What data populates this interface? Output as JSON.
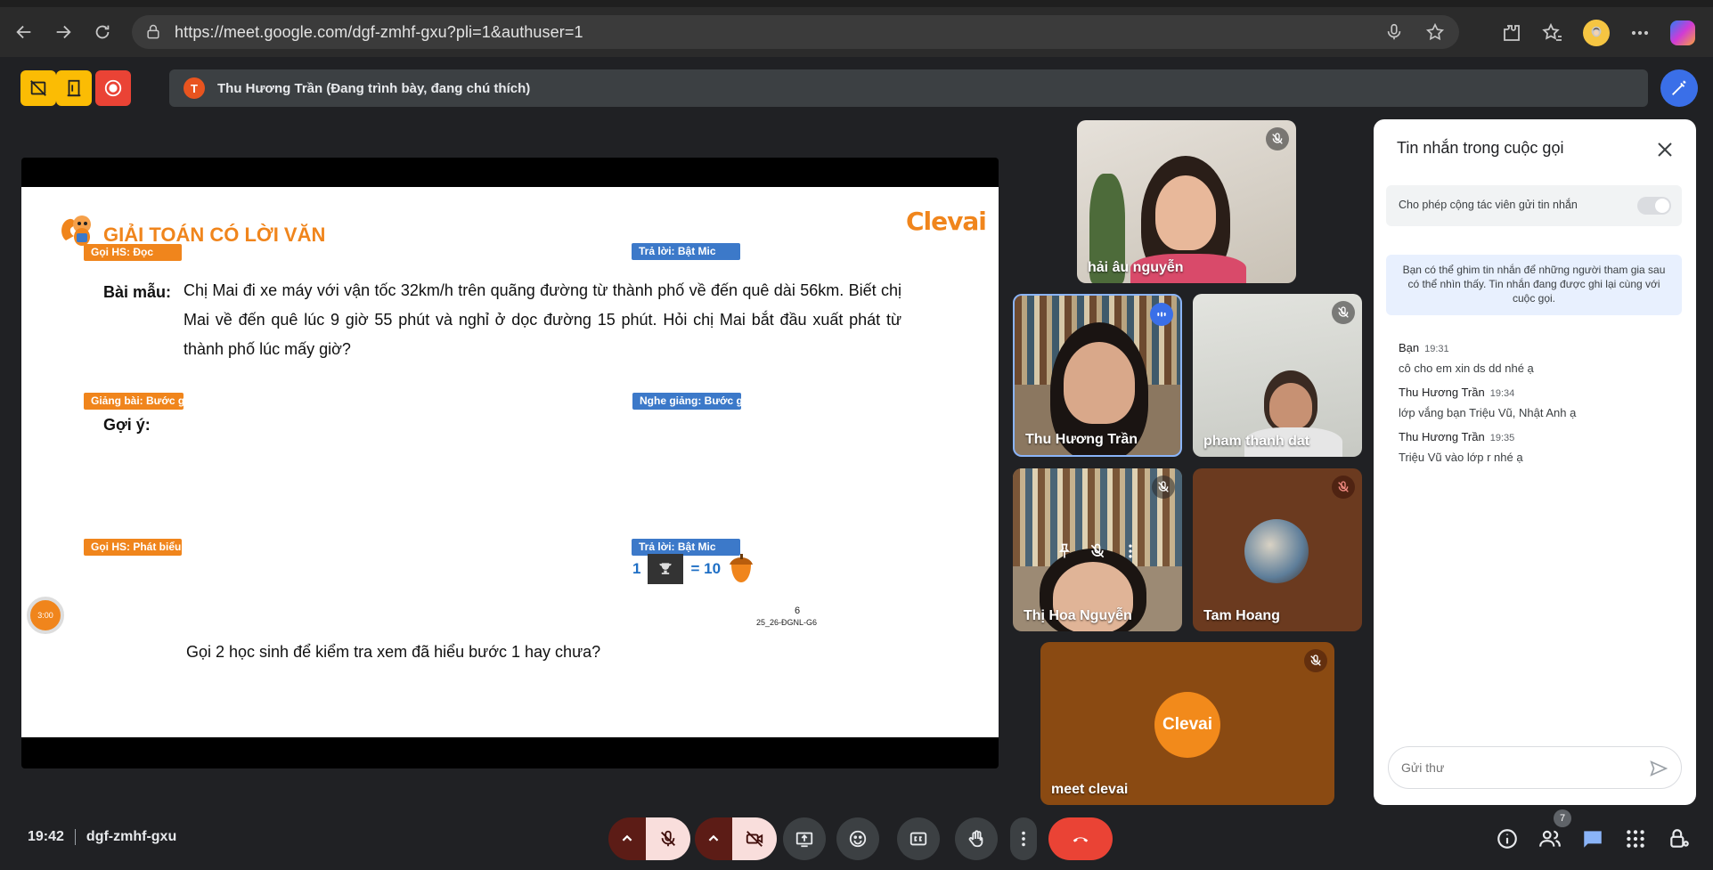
{
  "browser": {
    "url": "https://meet.google.com/dgf-zmhf-gxu?pli=1&authuser=1"
  },
  "topbar": {
    "presenter_initial": "T",
    "presenter_text": "Thu Hương Trần (Đang trình bày, đang chú thích)"
  },
  "slide": {
    "title": "GIẢI TOÁN CÓ LỜI VĂN",
    "brand": "Clevai",
    "tag_goi_hs_doc": "Gọi HS: Đọc",
    "tag_tra_loi_1": "Trả lời: Bật Mic",
    "bai_mau_label": "Bài mẫu:",
    "problem": "Chị Mai đi xe máy với vận tốc 32km/h trên quãng đường từ thành phố về đến quê dài 56km. Biết chị Mai về đến quê lúc 9 giờ 55 phút và nghỉ ở dọc đường 15 phút. Hỏi chị Mai bắt đầu xuất phát từ thành phố lúc mấy giờ?",
    "goi_y_label": "Gợi ý:",
    "tag_giang_bai": "Giảng bài: Bước giải",
    "tag_nghe_giang": "Nghe giảng: Bước giải",
    "tag_goi_hs_phat_bieu": "Gọi HS: Phát biểu",
    "tag_tra_loi_2": "Trả lời: Bật Mic",
    "question": "Gọi 2 học sinh để kiểm tra xem đã hiểu bước 1 hay chưa?",
    "reward_count": "1",
    "reward_value": "= 10",
    "page_number": "6",
    "slide_code": "25_26-ĐGNL-G6",
    "timer": "3:00"
  },
  "participants": [
    {
      "name": "hải âu nguyễn"
    },
    {
      "name": "Thu Hương Trần"
    },
    {
      "name": "pham thanh dat"
    },
    {
      "name": "Thị Hoa Nguyễn"
    },
    {
      "name": "Tam Hoang"
    },
    {
      "name": "meet clevai",
      "logo": "Clevai"
    }
  ],
  "chat": {
    "title": "Tin nhắn trong cuộc gọi",
    "allow_label": "Cho phép cộng tác viên gửi tin nhắn",
    "info": "Bạn có thể ghim tin nhắn để những người tham gia sau có thể nhìn thấy. Tin nhắn đang được ghi lại cùng với cuộc gọi.",
    "messages": [
      {
        "sender": "Bạn",
        "time": "19:31",
        "text": "cô cho em xin ds dd nhé ạ"
      },
      {
        "sender": "Thu Hương Trần",
        "time": "19:34",
        "text": "lớp vắng bạn Triệu Vũ, Nhật Anh ạ"
      },
      {
        "sender": "Thu Hương Trần",
        "time": "19:35",
        "text": "Triệu Vũ vào lớp r nhé ạ"
      }
    ],
    "input_placeholder": "Gửi thư"
  },
  "bottombar": {
    "time": "19:42",
    "meeting_code": "dgf-zmhf-gxu",
    "participant_count": "7"
  },
  "colors": {
    "accent_orange": "#f0851c",
    "tag_blue": "#3c79c9",
    "end_call_red": "#ea4335"
  }
}
